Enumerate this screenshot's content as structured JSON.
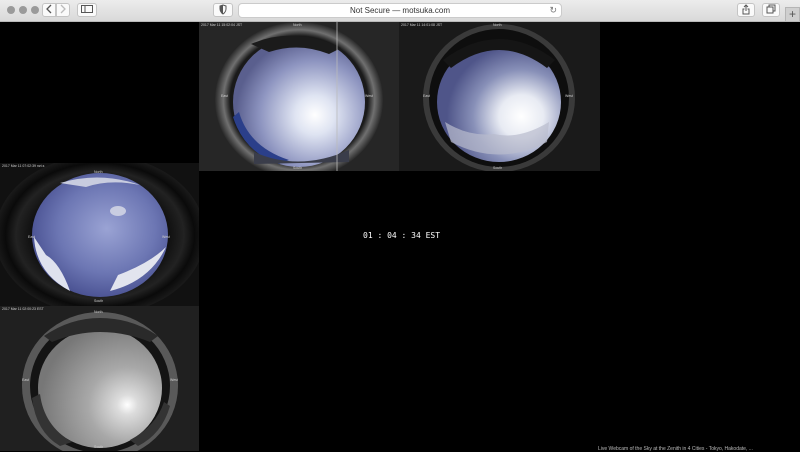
{
  "browser": {
    "address": "Not Secure — motsuka.com",
    "icons": [
      "back-icon",
      "forward-icon",
      "sidebar-icon",
      "shield-icon",
      "reload-icon",
      "share-icon",
      "tabs-icon",
      "plus-icon"
    ]
  },
  "cameras": [
    {
      "timestamp": "2017 Mar 11  15:02:04 JST",
      "north": "North",
      "south": "South",
      "east": "East",
      "west": "West"
    },
    {
      "timestamp": "2017 Mar 11  14:01:08 JST",
      "north": "North",
      "south": "South",
      "east": "East",
      "west": "West"
    },
    {
      "timestamp": "2017 Mar 11  07:02:39 nzt.s",
      "north": "North",
      "south": "South",
      "east": "East",
      "west": "West"
    },
    {
      "timestamp": "2017 Mar 11  02:00:23 EST",
      "north": "North",
      "south": "South",
      "east": "East",
      "west": "West"
    }
  ],
  "clock": "01 : 04 : 34 EST",
  "footer": "Live Webcam of the Sky at the Zenith in 4 Cities - Tokyo, Hakodate, ..."
}
